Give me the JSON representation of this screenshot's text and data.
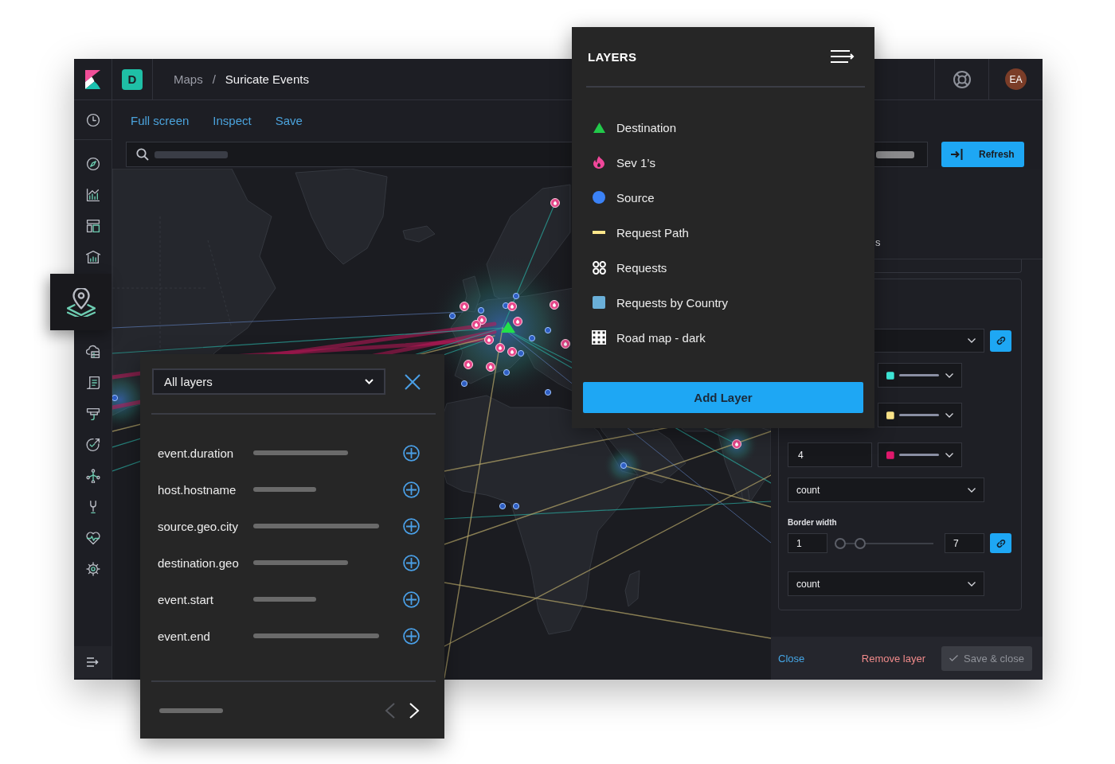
{
  "header": {
    "space_initial": "D",
    "breadcrumb": {
      "separator": "/",
      "items": [
        {
          "label": "Maps",
          "current": false
        },
        {
          "label": "Suricate Events",
          "current": true
        }
      ]
    },
    "avatar_initials": "EA"
  },
  "sidebar": {
    "items": [
      {
        "selected": false
      },
      {
        "selected": false
      },
      {
        "selected": false
      },
      {
        "selected": false
      },
      {
        "selected": false
      },
      {
        "selected": true
      },
      {
        "selected": false
      },
      {
        "selected": false
      },
      {
        "selected": false
      },
      {
        "selected": false
      },
      {
        "selected": false
      },
      {
        "selected": false
      },
      {
        "selected": false
      },
      {
        "selected": false
      }
    ]
  },
  "toolbar": {
    "links": [
      "Full screen",
      "Inspect",
      "Save"
    ]
  },
  "query_bar": {
    "refresh_button": "Refresh"
  },
  "layer_settings": {
    "header_fragment": "s",
    "style_card": {
      "color_rows": [
        {
          "color": "#3ee8d8"
        },
        {
          "color": "#fde68a"
        },
        {
          "value": "4",
          "color": "#e0186c"
        }
      ],
      "metric_select": "count",
      "border_width": {
        "label": "Border width",
        "min_value": "1",
        "max_value": "7",
        "thumbs": [
          {
            "level": 0
          },
          {
            "level": 0.23
          }
        ]
      },
      "border_metric_select": "count"
    },
    "footer": {
      "close": "Close",
      "remove": "Remove layer",
      "save": {
        "label": "Save & close",
        "disabled": true
      }
    }
  },
  "layers_panel": {
    "title": "LAYERS",
    "layers": [
      {
        "kind": "triangle",
        "name": "Destination",
        "color": "#22c94a"
      },
      {
        "kind": "flame",
        "name": "Sev 1’s",
        "color": "#f0479a"
      },
      {
        "kind": "circle",
        "name": "Source",
        "color": "#3b82f6"
      },
      {
        "kind": "line",
        "name": "Request Path",
        "color": "#fde68a"
      },
      {
        "kind": "cluster",
        "name": "Requests",
        "color": "#ffffff"
      },
      {
        "kind": "square",
        "name": "Requests by Country",
        "color": "#6aafd8"
      },
      {
        "kind": "grid",
        "name": "Road map - dark",
        "color": "#ffffff"
      }
    ],
    "add_button": "Add Layer"
  },
  "fields_panel": {
    "layer_select": "All layers",
    "fields": [
      "event.duration",
      "host.hostname",
      "source.geo.city",
      "destination.geo",
      "event.start",
      "event.end"
    ],
    "pager": [
      {
        "kind": "prev",
        "disabled": true
      },
      {
        "kind": "next",
        "disabled": false
      }
    ]
  }
}
